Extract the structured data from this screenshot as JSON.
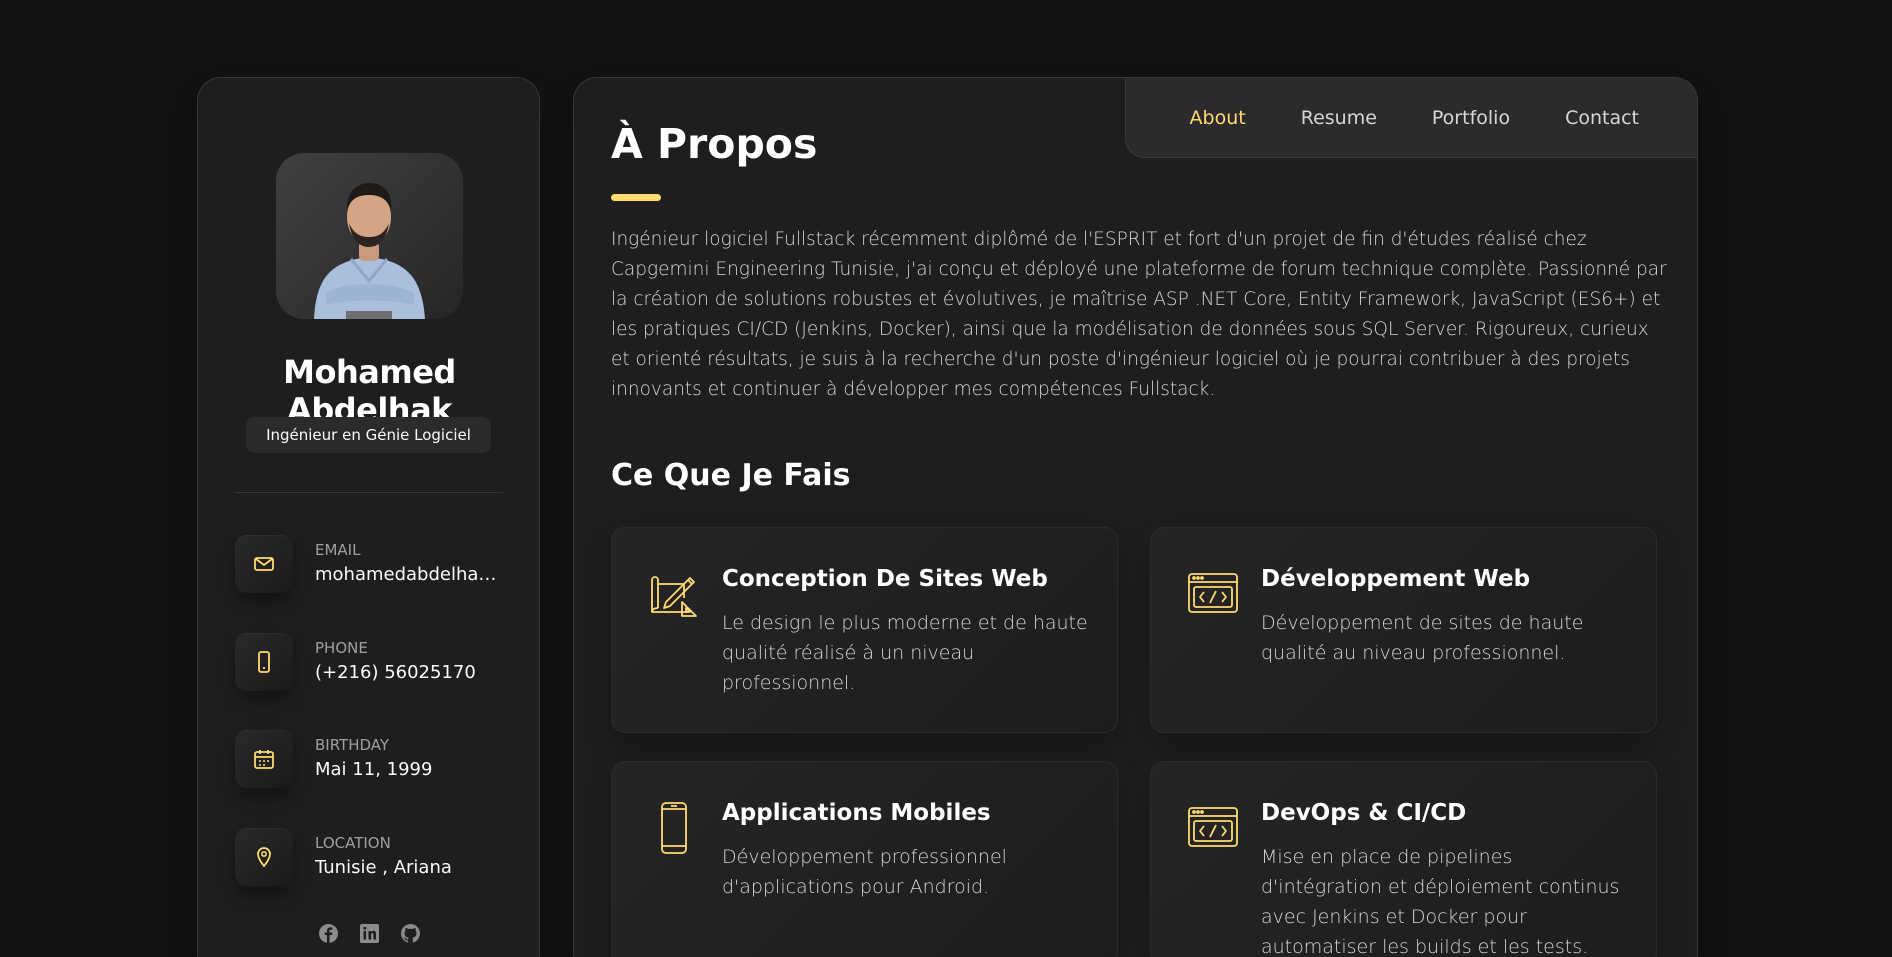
{
  "colors": {
    "accent": "#ffdb70",
    "background": "#121212",
    "card": "#1e1e1f"
  },
  "sidebar": {
    "name": "Mohamed Abdelhak",
    "title": "Ingénieur en Génie Logiciel",
    "contacts": [
      {
        "label": "EMAIL",
        "value": "mohamedabdelhak...",
        "icon": "mail-icon"
      },
      {
        "label": "PHONE",
        "value": "(+216) 56025170",
        "icon": "phone-icon"
      },
      {
        "label": "BIRTHDAY",
        "value": "Mai 11, 1999",
        "icon": "calendar-icon"
      },
      {
        "label": "LOCATION",
        "value": "Tunisie , Ariana",
        "icon": "location-icon"
      }
    ],
    "socials": [
      "facebook-icon",
      "linkedin-icon",
      "github-icon"
    ]
  },
  "nav": {
    "items": [
      {
        "label": "About",
        "active": true
      },
      {
        "label": "Resume",
        "active": false
      },
      {
        "label": "Portfolio",
        "active": false
      },
      {
        "label": "Contact",
        "active": false
      }
    ]
  },
  "about": {
    "heading": "À Propos",
    "text": "Ingénieur logiciel Fullstack récemment diplômé de l'ESPRIT et fort d'un projet de fin d'études réalisé chez Capgemini Engineering Tunisie, j'ai conçu et déployé une plateforme de forum technique complète. Passionné par la création de solutions robustes et évolutives, je maîtrise ASP .NET Core, Entity Framework, JavaScript (ES6+) et les pratiques CI/CD (Jenkins, Docker), ainsi que la modélisation de données sous SQL Server. Rigoureux, curieux et orienté résultats, je suis à la recherche d'un poste d'ingénieur logiciel où je pourrai contribuer à des projets innovants et continuer à développer mes compétences Fullstack."
  },
  "services": {
    "heading": "Ce Que Je Fais",
    "items": [
      {
        "title": "Conception De Sites Web",
        "description": "Le design le plus moderne et de haute qualité réalisé à un niveau professionnel.",
        "icon": "design-icon"
      },
      {
        "title": "Développement Web",
        "description": "Développement de sites de haute qualité au niveau professionnel.",
        "icon": "code-window-icon"
      },
      {
        "title": "Applications Mobiles",
        "description": "Développement professionnel d'applications pour Android.",
        "icon": "mobile-icon"
      },
      {
        "title": "DevOps & CI/CD",
        "description": "Mise en place de pipelines d'intégration et déploiement continus avec Jenkins et Docker pour automatiser les builds et les tests.",
        "icon": "code-window-icon"
      }
    ]
  }
}
